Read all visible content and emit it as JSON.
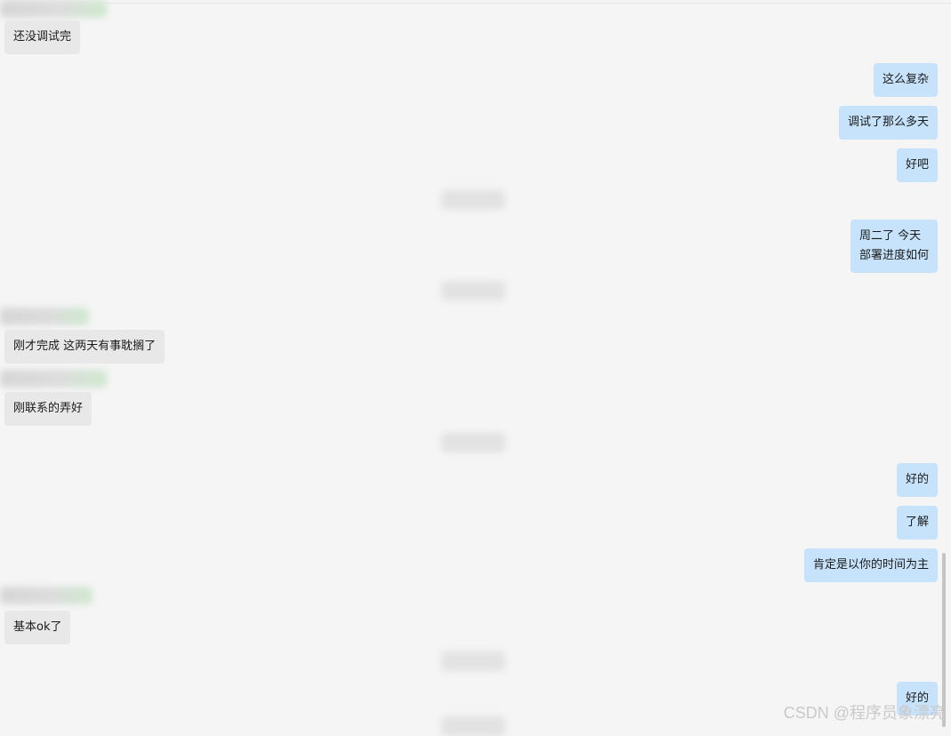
{
  "chat": {
    "messages": [
      {
        "side": "left",
        "text": "还没调试完"
      },
      {
        "side": "right",
        "text": "这么复杂"
      },
      {
        "side": "right",
        "text": "调试了那么多天"
      },
      {
        "side": "right",
        "text": "好吧"
      },
      {
        "side": "right",
        "line1": "周二了 今天",
        "line2": "部署进度如何"
      },
      {
        "side": "left",
        "text": "刚才完成 这两天有事耽搁了"
      },
      {
        "side": "left",
        "text": "刚联系的弄好"
      },
      {
        "side": "right",
        "text": "好的"
      },
      {
        "side": "right",
        "text": "了解"
      },
      {
        "side": "right",
        "text": "肯定是以你的时间为主"
      },
      {
        "side": "left",
        "text": "基本ok了"
      },
      {
        "side": "right",
        "text": "好的"
      }
    ]
  },
  "watermark": {
    "text": "CSDN @程序员象漂亮"
  },
  "colors": {
    "background": "#f5f5f5",
    "incoming_bubble": "#e8e8e8",
    "outgoing_bubble": "#c6e3fb"
  }
}
